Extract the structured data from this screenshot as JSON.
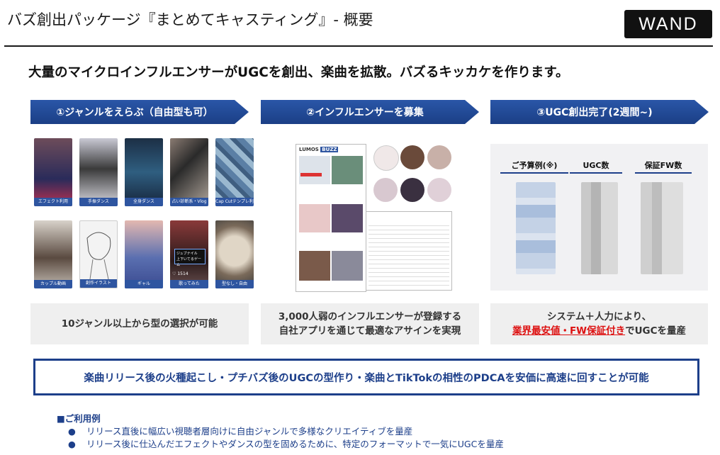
{
  "header": {
    "title": "バズ創出パッケージ『まとめてキャスティング』- 概要",
    "logo": "WAND"
  },
  "headline": "大量のマイクロインフルエンサーがUGCを創出、楽曲を拡散。バズるキッカケを作ります。",
  "steps": [
    {
      "label": "①ジャンルをえらぶ（自由型も可）"
    },
    {
      "label": "②インフルエンサーを募集"
    },
    {
      "label": "③UGC創出完了(2週間~)"
    }
  ],
  "genres": [
    "エフェクト利用",
    "手振ダンス",
    "全身ダンス",
    "占い診断系・Vlog",
    "Cap Cutテンプレ利用",
    "カップル動画",
    "創作イラスト",
    "ギャル",
    "歌ってみた",
    "型なし・自由"
  ],
  "thumb_overlay": {
    "text1": "ジュブナイル",
    "text2": "上下いてるゲーム",
    "count": "1514"
  },
  "app_screen": {
    "brand1": "LUMOS",
    "brand2": "BUZZ"
  },
  "table_headers": {
    "budget": "ご予算例(※)",
    "ugc": "UGC数",
    "fw": "保証FW数"
  },
  "descriptions": {
    "step1": "10ジャンル以上から型の選択が可能",
    "step2_line1": "3,000人弱のインフルエンサーが登録する",
    "step2_line2": "自社アプリを通じて最適なアサインを実現",
    "step3_line1": "システム＋人力により、",
    "step3_red": "業界最安値・FW保証付き",
    "step3_rest": "でUGCを量産"
  },
  "banner": "楽曲リリース後の火種起こし・プチバズ後のUGCの型作り・楽曲とTikTokの相性のPDCAを安価に高速に回すことが可能",
  "usage": {
    "title": "■ご利用例",
    "items": [
      "リリース直後に幅広い視聴者層向けに自由ジャンルで多様なクリエイティブを量産",
      "リリース後に仕込んだエフェクトやダンスの型を固めるために、特定のフォーマットで一気にUGCを量産"
    ],
    "bullet": "●"
  },
  "colors": {
    "primary_blue": "#1d3f8a",
    "accent_red": "#dd1111",
    "gray_panel": "#efefef"
  }
}
